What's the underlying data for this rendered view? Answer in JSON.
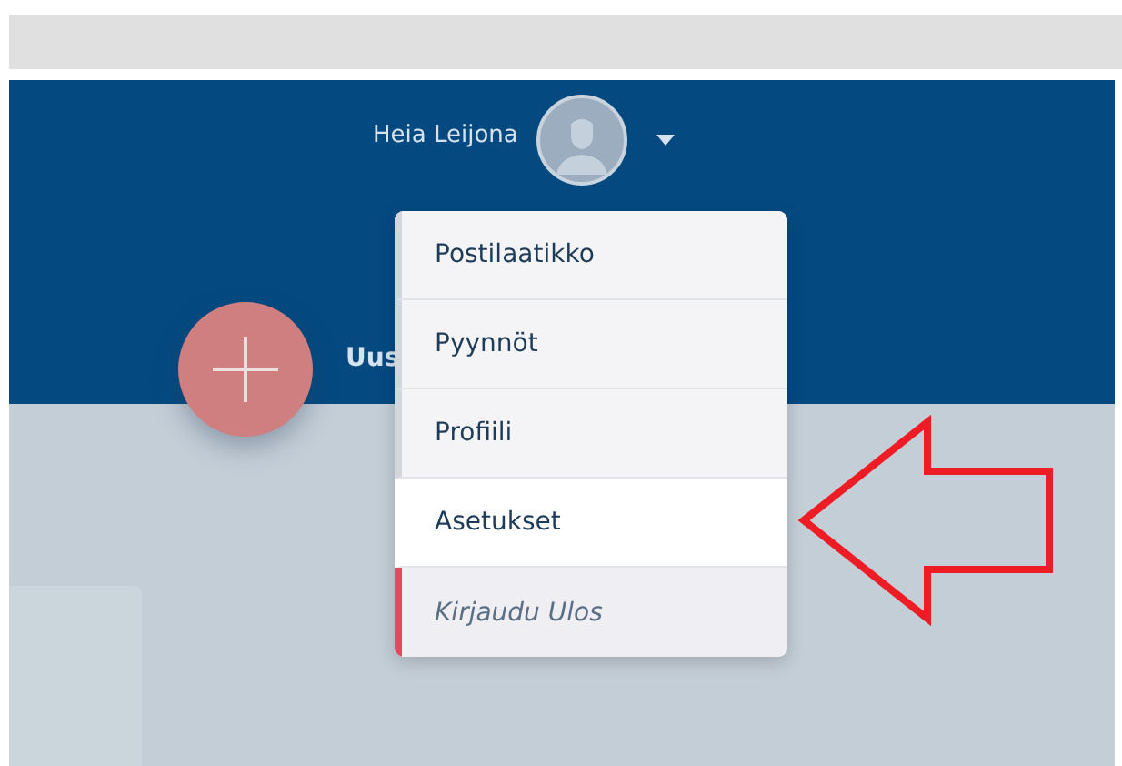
{
  "header": {
    "user_name": "Heia Leijona"
  },
  "new_action": {
    "label": "Uus"
  },
  "menu": {
    "items": [
      {
        "label": "Postilaatikko",
        "kind": "link",
        "selected": false
      },
      {
        "label": "Pyynnöt",
        "kind": "link",
        "selected": false
      },
      {
        "label": "Profiili",
        "kind": "link",
        "selected": false
      },
      {
        "label": "Asetukset",
        "kind": "link",
        "selected": true
      },
      {
        "label": "Kirjaudu Ulos",
        "kind": "logout",
        "selected": false
      }
    ]
  }
}
